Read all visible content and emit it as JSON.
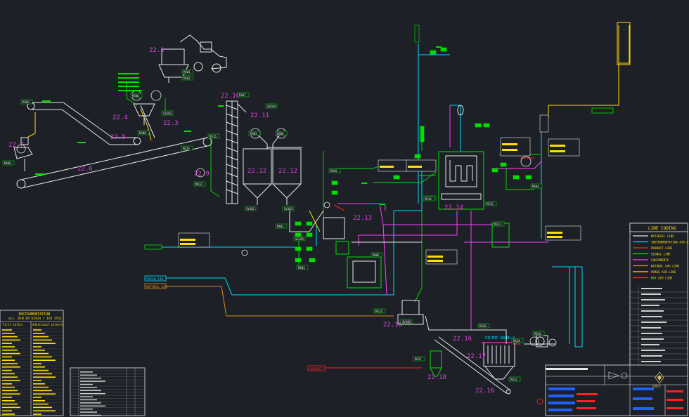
{
  "process_tags": [
    "22.1",
    "22.2",
    "22.3",
    "22.4",
    "22.5",
    "22.6",
    "22.7",
    "22.9",
    "22.10",
    "22.11",
    "22.12",
    "22.12",
    "22.13",
    "22.14",
    "22.15",
    "22.16",
    "22.16",
    "22.17",
    "22.18"
  ],
  "equipment_tags": [
    "M301",
    "M302",
    "M303",
    "M306",
    "M305",
    "M304",
    "M307",
    "M308",
    "M310",
    "M311",
    "M312",
    "M313",
    "M314",
    "M315",
    "M316",
    "M320",
    "M401",
    "M402",
    "M403",
    "M404",
    "M405",
    "M408",
    "M410",
    "M412",
    "M414",
    "M416",
    "M417",
    "SV101",
    "SV102",
    "SV103",
    "SV104",
    "SV105",
    "SV106"
  ],
  "stream_labels": [
    "FRESH AIR",
    "NATURAL GAS",
    "PRODUCT"
  ],
  "legend": {
    "title": "LINE CODING",
    "items": [
      {
        "label": "MATERIAL LINE",
        "color": "#e8e8e8"
      },
      {
        "label": "INSTRUMENTATION AIR LINE",
        "color": "#00d8ff"
      },
      {
        "label": "PRODUCT LINE",
        "color": "#ff2020"
      },
      {
        "label": "SIGNAL LINE",
        "color": "#00e000"
      },
      {
        "label": "EQUIPMENTS",
        "color": "#ff40ff"
      },
      {
        "label": "NATURAL GAS LINE",
        "color": "#d88a20"
      },
      {
        "label": "PURGE AIR LINE",
        "color": "#ffe000"
      },
      {
        "label": "HOT AIR LINE",
        "color": "#ff2020"
      }
    ]
  },
  "instrumentation_table": {
    "title": "INSTRUMENTATION",
    "subtitle": "acc. DIN EN 62424 / ISO 3511",
    "col1": "First Letter",
    "col2": "Additional Letters"
  },
  "filter_label": "FILTRE GRUBU-2",
  "title_block": {
    "logo_text": "ENTE"
  },
  "colors": {
    "background": "#1d2127",
    "material": "#e8e8e8",
    "instrument_air": "#00d8ff",
    "product": "#ff2020",
    "signal": "#00e000",
    "equipment": "#ff40ff",
    "natural_gas": "#d88a20",
    "purge_air": "#ffe000",
    "tag": "#e040e0"
  }
}
